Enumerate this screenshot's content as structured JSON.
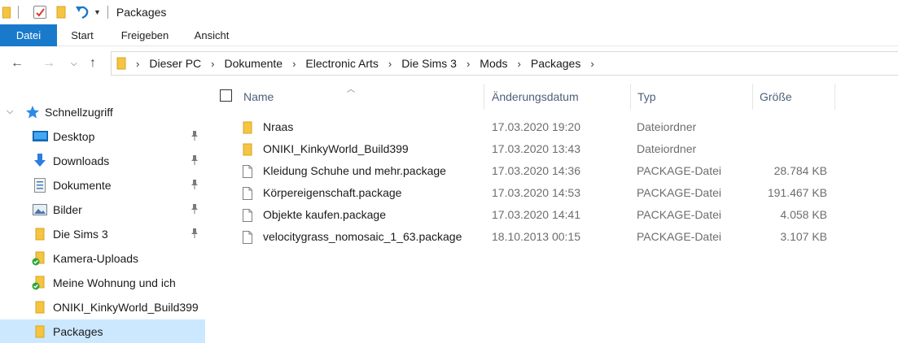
{
  "window": {
    "title": "Packages"
  },
  "ribbon": {
    "tabs": [
      "Datei",
      "Start",
      "Freigeben",
      "Ansicht"
    ]
  },
  "address": {
    "breadcrumbs": [
      "Dieser PC",
      "Dokumente",
      "Electronic Arts",
      "Die Sims 3",
      "Mods",
      "Packages"
    ]
  },
  "nav": {
    "quick_access_label": "Schnellzugriff",
    "items": [
      {
        "label": "Desktop",
        "icon": "desktop-icon",
        "pinned": true
      },
      {
        "label": "Downloads",
        "icon": "downloads-icon",
        "pinned": true
      },
      {
        "label": "Dokumente",
        "icon": "documents-icon",
        "pinned": true
      },
      {
        "label": "Bilder",
        "icon": "pictures-icon",
        "pinned": true
      },
      {
        "label": "Die Sims 3",
        "icon": "folder-icon",
        "pinned": true
      },
      {
        "label": "Kamera-Uploads",
        "icon": "synced-folder-icon",
        "pinned": false
      },
      {
        "label": "Meine Wohnung und ich",
        "icon": "synced-folder-icon",
        "pinned": false
      },
      {
        "label": "ONIKI_KinkyWorld_Build399",
        "icon": "folder-icon",
        "pinned": false
      },
      {
        "label": "Packages",
        "icon": "folder-icon",
        "pinned": false,
        "selected": true
      }
    ]
  },
  "columns": {
    "name": "Name",
    "date": "Änderungsdatum",
    "type": "Typ",
    "size": "Größe"
  },
  "files": [
    {
      "name": "Nraas",
      "date": "17.03.2020 19:20",
      "type": "Dateiordner",
      "size": "",
      "icon": "folder-icon"
    },
    {
      "name": "ONIKI_KinkyWorld_Build399",
      "date": "17.03.2020 13:43",
      "type": "Dateiordner",
      "size": "",
      "icon": "folder-icon"
    },
    {
      "name": "Kleidung Schuhe und mehr.package",
      "date": "17.03.2020 14:36",
      "type": "PACKAGE-Datei",
      "size": "28.784 KB",
      "icon": "file-icon"
    },
    {
      "name": "Körpereigenschaft.package",
      "date": "17.03.2020 14:53",
      "type": "PACKAGE-Datei",
      "size": "191.467 KB",
      "icon": "file-icon"
    },
    {
      "name": "Objekte kaufen.package",
      "date": "17.03.2020 14:41",
      "type": "PACKAGE-Datei",
      "size": "4.058 KB",
      "icon": "file-icon"
    },
    {
      "name": "velocitygrass_nomosaic_1_63.package",
      "date": "18.10.2013 00:15",
      "type": "PACKAGE-Datei",
      "size": "3.107 KB",
      "icon": "file-icon"
    }
  ],
  "colors": {
    "accent": "#1979ca",
    "selection": "#cce8ff",
    "folder": "#f5c542",
    "header_text": "#4c607a"
  }
}
